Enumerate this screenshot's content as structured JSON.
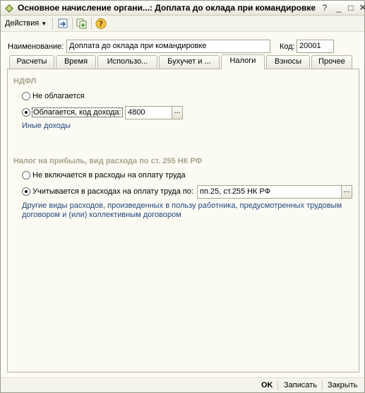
{
  "window": {
    "title": "Основное начисление органи...: Доплата до оклада при командировке",
    "controls": {
      "help": "?",
      "minimize": "_",
      "maximize": "□",
      "close": "✕"
    }
  },
  "toolbar": {
    "actions_label": "Действия"
  },
  "header": {
    "name_label": "Наименование:",
    "name_value": "Доплата до оклада при командировке",
    "code_label": "Код:",
    "code_value": "20001"
  },
  "tabs": [
    {
      "label": "Расчеты",
      "active": false
    },
    {
      "label": "Время",
      "active": false
    },
    {
      "label": "Использо...",
      "active": false
    },
    {
      "label": "Бухучет и ...",
      "active": false
    },
    {
      "label": "Налоги",
      "active": true
    },
    {
      "label": "Взносы",
      "active": false
    },
    {
      "label": "Прочее",
      "active": false
    }
  ],
  "ndfl": {
    "section_title": "НДФЛ",
    "option_not_taxed": "Не облагается",
    "option_taxed": "Облагается, код дохода:",
    "income_code": "4800",
    "income_link": "Иные доходы",
    "selected": "taxed"
  },
  "profit_tax": {
    "section_title": "Налог на прибыль, вид расхода по ст. 255 НК РФ",
    "option_not_included": "Не включается в расходы на оплату труда",
    "option_included": "Учитывается в расходах на оплату труда по:",
    "article_value": "пп.25, ст.255 НК РФ",
    "description_line1": "Другие виды расходов, произведенных в пользу работника, предусмотренных трудовым",
    "description_line2": "договором и (или) коллективным договором",
    "selected": "included"
  },
  "footer": {
    "ok_label": "OK",
    "save_label": "Записать",
    "close_label": "Закрыть"
  },
  "icons": [
    "app-logo-icon",
    "dropdown-arrow-icon",
    "go-to-icon",
    "copy-icon",
    "help-icon",
    "select-dots-icon"
  ],
  "colors": {
    "background": "#fbfaf3",
    "section_title": "#a6a48c",
    "link": "#24477f"
  }
}
